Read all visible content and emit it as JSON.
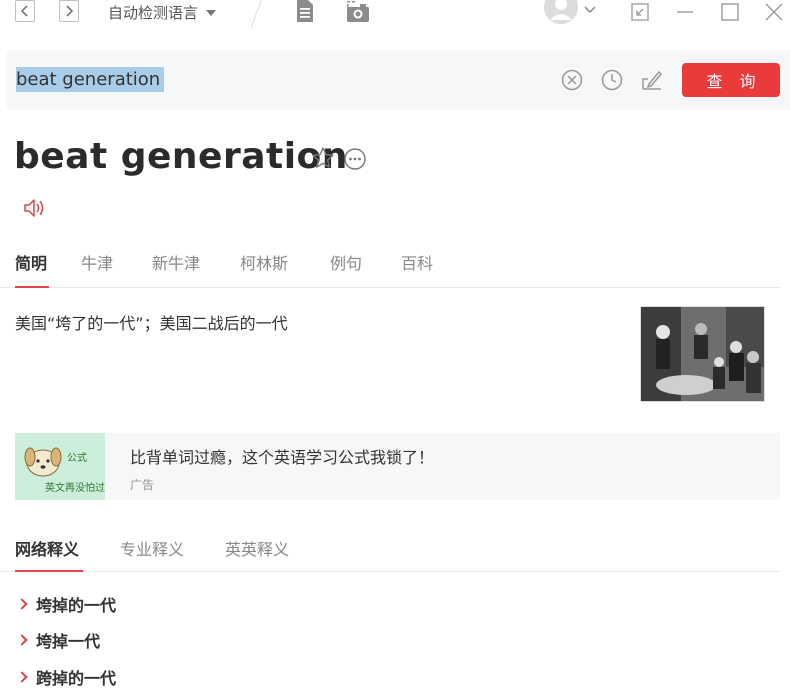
{
  "titlebar": {
    "language_select": "自动检测语言",
    "colors": {
      "icon": "#8c8c8c",
      "divider": "#dddddd"
    },
    "icons": [
      "back-icon",
      "forward-icon",
      "document-icon",
      "screenshot-icon",
      "avatar-icon",
      "chevron-down-icon",
      "mini-mode-icon",
      "minimize-icon",
      "maximize-icon",
      "close-icon"
    ]
  },
  "search": {
    "value": "beat generation",
    "query_button": "查 询",
    "icons": [
      "clear-icon",
      "history-icon",
      "handwriting-icon"
    ],
    "colors": {
      "button": "#ea3a3a",
      "selection": "#a9cde9",
      "bar_bg": "#f5f7f8"
    }
  },
  "entry": {
    "headword": "beat generation",
    "icons": [
      "star-icon",
      "more-icon",
      "speaker-icon"
    ]
  },
  "tabs": {
    "items": [
      {
        "label": "简明",
        "active": true
      },
      {
        "label": "牛津",
        "active": false
      },
      {
        "label": "新牛津",
        "active": false
      },
      {
        "label": "柯林斯",
        "active": false
      },
      {
        "label": "例句",
        "active": false
      },
      {
        "label": "百科",
        "active": false
      }
    ],
    "accent": "#e0464a"
  },
  "definition": {
    "text": "美国“垮了的一代”；美国二战后的一代"
  },
  "ad": {
    "title": "比背单词过瘾，这个英语学习公式我锁了！",
    "label": "广告",
    "image_text_1": "公式",
    "image_text_2": "英文再没怕过!"
  },
  "net_tabs": {
    "items": [
      {
        "label": "网络释义",
        "active": true
      },
      {
        "label": "专业释义",
        "active": false
      },
      {
        "label": "英英释义",
        "active": false
      }
    ]
  },
  "meanings": [
    {
      "text": "垮掉的一代"
    },
    {
      "text": "垮掉一代"
    },
    {
      "text": "跨掉的一代"
    }
  ]
}
